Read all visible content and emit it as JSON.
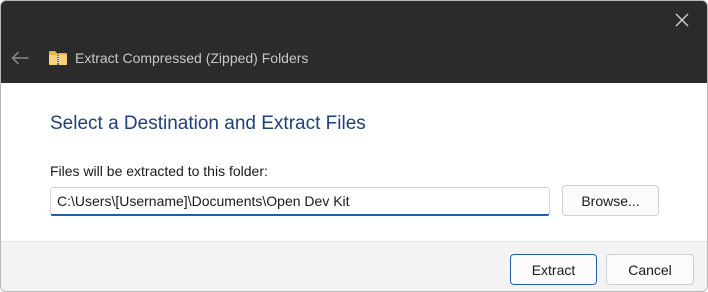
{
  "window": {
    "title": "Extract Compressed (Zipped) Folders",
    "icons": {
      "close": "close-icon",
      "back": "back-arrow-icon",
      "app": "zipped-folder-icon"
    }
  },
  "main": {
    "heading": "Select a Destination and Extract Files",
    "destination_label": "Files will be extracted to this folder:",
    "destination_path": "C:\\Users\\[Username]\\Documents\\Open Dev Kit",
    "browse_label": "Browse..."
  },
  "footer": {
    "extract_label": "Extract",
    "cancel_label": "Cancel"
  },
  "colors": {
    "titlebar_bg": "#2b2b2b",
    "heading": "#1f3f7a",
    "accent": "#1f5fa8",
    "footer_bg": "#f3f3f3"
  }
}
